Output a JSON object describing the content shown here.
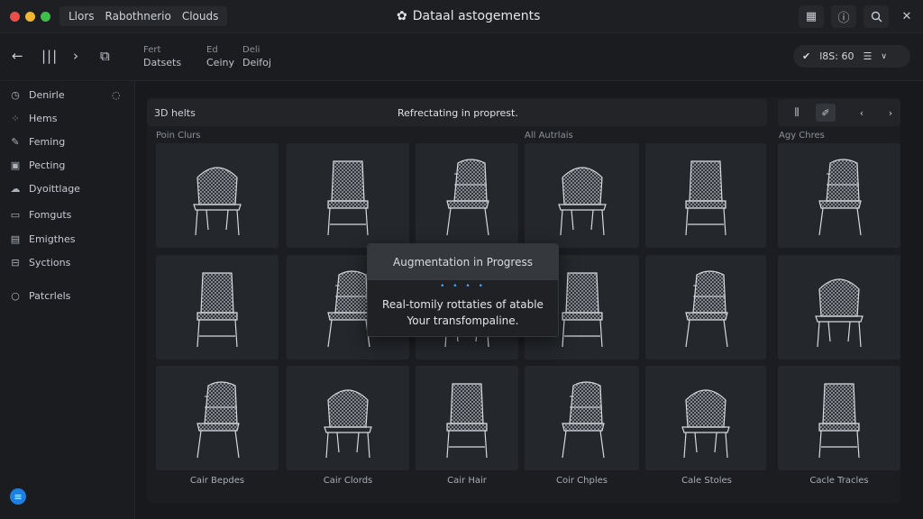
{
  "window": {
    "breadcrumb": [
      "Llors",
      "Rabothnerio",
      "Clouds"
    ],
    "title": "Dataal astogements",
    "title_icon": "gear-icon",
    "controls": [
      "grid-icon",
      "info-icon",
      "search-icon",
      "close-icon"
    ]
  },
  "toolbar": {
    "columns": [
      {
        "top": "Fert",
        "bottom": "Datsets"
      },
      {
        "top": "Ed",
        "bottom": "Ceiny"
      },
      {
        "top": "Deli",
        "bottom": "Deifoj"
      }
    ],
    "status_text": "l8S: 60"
  },
  "sidebar": {
    "items": [
      {
        "label": "Denirle",
        "icon": "clock-icon"
      },
      {
        "label": "Hems",
        "icon": "grid-icon"
      },
      {
        "label": "Feming",
        "icon": "pen-icon"
      },
      {
        "label": "Pecting",
        "icon": "image-icon"
      },
      {
        "label": "Dyoittlage",
        "icon": "cloud-icon"
      },
      {
        "label": "Fomguts",
        "icon": "layout-icon"
      },
      {
        "label": "Emigthes",
        "icon": "document-icon"
      },
      {
        "label": "Syctions",
        "icon": "table-icon"
      },
      {
        "label": "Patcrlels",
        "icon": "circle-icon"
      }
    ]
  },
  "main": {
    "head_left": "3D helts",
    "head_status": "Refrectating in proprest.",
    "group_labels": [
      "Poin Clurs",
      "All Autrlais",
      "Agy Chres"
    ],
    "captions": [
      "Cair Bepdes",
      "Cair Clords",
      "Cair Hair",
      "Coir Chples",
      "Cale Stoles",
      "Cacle Tracles"
    ]
  },
  "modal": {
    "title": "Augmentation in Progress",
    "dots": "• • • •",
    "line1": "Real-tomily rottaties of atable",
    "line2": "Your transfompaline."
  },
  "colors": {
    "accent": "#1f7fe0",
    "close": "#ec4f4a",
    "minimize": "#f2b630",
    "maximize": "#3fbf4a"
  }
}
